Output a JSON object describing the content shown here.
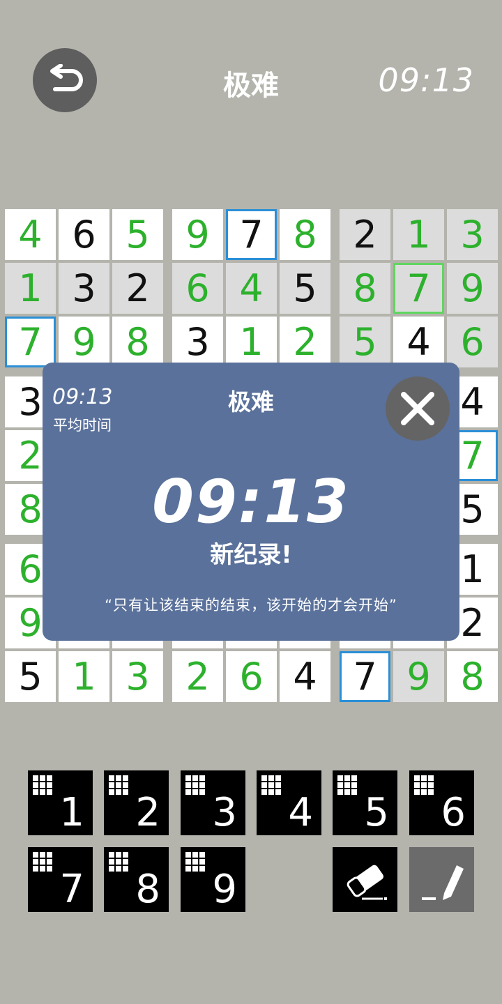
{
  "header": {
    "back_icon": "undo-arrow-icon",
    "title": "极难",
    "timer": "09:13"
  },
  "board": {
    "rows": [
      [
        "4",
        "6",
        "5",
        "9",
        "7",
        "8",
        "2",
        "1",
        "3"
      ],
      [
        "1",
        "3",
        "2",
        "6",
        "4",
        "5",
        "8",
        "7",
        "9"
      ],
      [
        "7",
        "9",
        "8",
        "3",
        "1",
        "2",
        "5",
        "4",
        "6"
      ],
      [
        "3",
        "",
        "",
        "",
        "",
        "",
        "",
        "",
        "4"
      ],
      [
        "2",
        "",
        "",
        "",
        "",
        "",
        "",
        "",
        "7"
      ],
      [
        "8",
        "",
        "",
        "",
        "",
        "",
        "",
        "",
        "5"
      ],
      [
        "6",
        "",
        "",
        "",
        "",
        "",
        "",
        "",
        "1"
      ],
      [
        "9",
        "",
        "",
        "",
        "",
        "",
        "",
        "",
        "2"
      ],
      [
        "5",
        "1",
        "3",
        "2",
        "6",
        "4",
        "7",
        "9",
        "8"
      ]
    ],
    "colors": [
      [
        "g",
        "b",
        "g",
        "g",
        "b",
        "g",
        "b",
        "g",
        "g"
      ],
      [
        "g",
        "b",
        "b",
        "g",
        "g",
        "b",
        "g",
        "g",
        "g"
      ],
      [
        "g",
        "g",
        "g",
        "b",
        "g",
        "g",
        "g",
        "b",
        "g"
      ],
      [
        "b",
        "",
        "",
        "",
        "",
        "",
        "",
        "",
        "b"
      ],
      [
        "g",
        "",
        "",
        "",
        "",
        "",
        "",
        "",
        "g"
      ],
      [
        "g",
        "",
        "",
        "",
        "",
        "",
        "",
        "",
        "b"
      ],
      [
        "g",
        "",
        "",
        "",
        "",
        "",
        "",
        "",
        "b"
      ],
      [
        "g",
        "",
        "",
        "",
        "",
        "",
        "",
        "",
        "b"
      ],
      [
        "b",
        "g",
        "g",
        "g",
        "g",
        "b",
        "b",
        "g",
        "g"
      ]
    ],
    "green_color": "#2db12d",
    "black_color": "#111111"
  },
  "dialog": {
    "avg_time": "09:13",
    "avg_label": "平均时间",
    "title": "极难",
    "close_icon": "close-x-icon",
    "big_time": "09:13",
    "record_label": "新纪录!",
    "quote": "“只有让该结束的结束，该开始的才会开始”",
    "bg_color": "#5a719b"
  },
  "keypad": {
    "keys": [
      "1",
      "2",
      "3",
      "4",
      "5",
      "6",
      "7",
      "8",
      "9"
    ],
    "grid_icon": "notes-grid-icon",
    "eraser_icon": "eraser-icon",
    "pencil_icon": "pencil-icon"
  }
}
